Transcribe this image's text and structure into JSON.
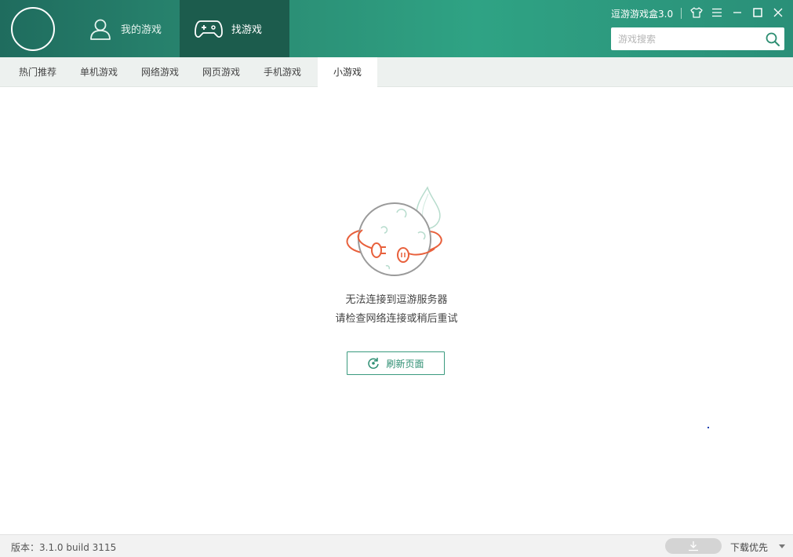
{
  "header": {
    "app_title": "逗游游戏盒3.0",
    "tabs": [
      {
        "label": "我的游戏",
        "icon": "user-icon"
      },
      {
        "label": "找游戏",
        "icon": "gamepad-icon",
        "active": true
      }
    ],
    "search": {
      "placeholder": "游戏搜索",
      "value": ""
    },
    "window_controls": [
      "skin-icon",
      "menu-icon",
      "minimize-icon",
      "maximize-icon",
      "close-icon"
    ]
  },
  "subnav": {
    "tabs": [
      {
        "label": "热门推荐"
      },
      {
        "label": "单机游戏"
      },
      {
        "label": "网络游戏"
      },
      {
        "label": "网页游戏"
      },
      {
        "label": "手机游戏"
      },
      {
        "label": "小游戏",
        "active": true
      }
    ]
  },
  "content": {
    "illustration": "disconnected-planet-icon",
    "message_line1": "无法连接到逗游服务器",
    "message_line2": "请检查网络连接或稍后重试",
    "refresh_label": "刷新页面"
  },
  "statusbar": {
    "version": "版本：3.1.0 build 3115",
    "download_priority_label": "下载优先"
  },
  "colors": {
    "header_green": "#2a8a72",
    "active_tab": "#1c5c4d",
    "accent": "#2d8e72",
    "orange": "#e8603c"
  }
}
